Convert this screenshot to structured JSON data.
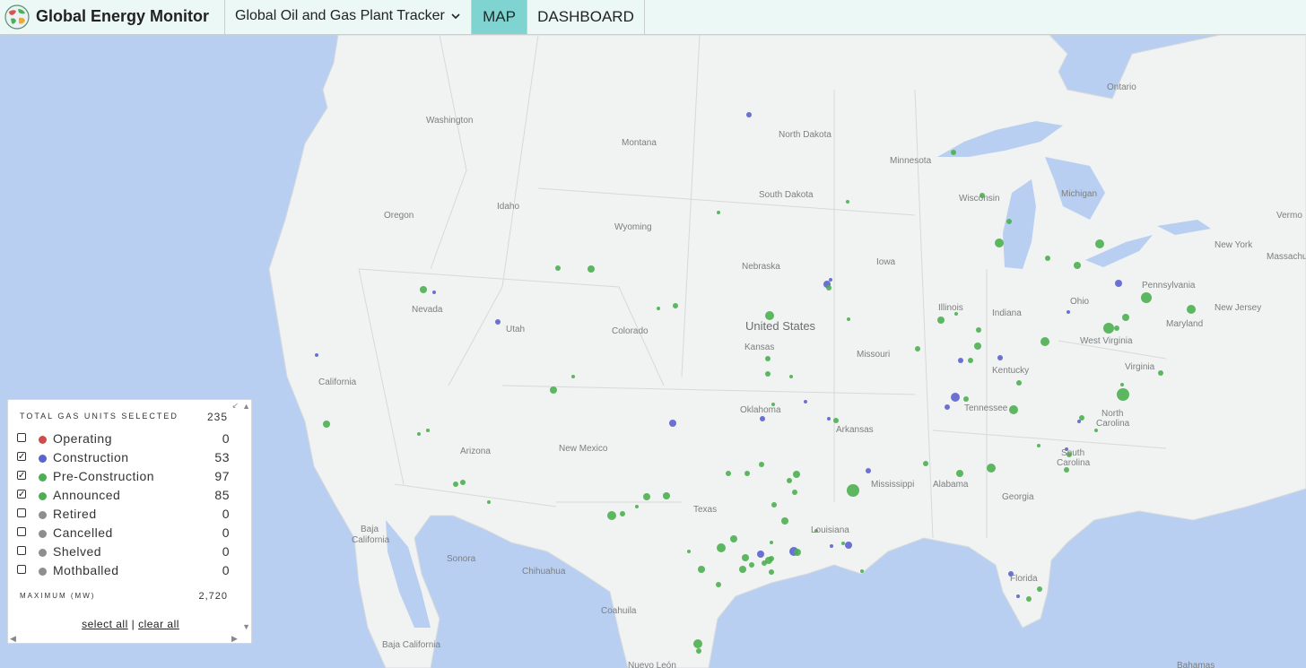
{
  "header": {
    "brand": "Global Energy Monitor",
    "tracker": "Global Oil and Gas Plant Tracker",
    "tabs": [
      "MAP",
      "DASHBOARD"
    ],
    "active_tab": "MAP"
  },
  "colors": {
    "operating": "#d04b4b",
    "construction": "#5b63cf",
    "preconstruction": "#4caf50",
    "announced": "#4caf50",
    "inactive": "#8e8e8e",
    "active_tab": "#7fd3d0",
    "water": "#b9cff1"
  },
  "map": {
    "labels": {
      "ontario": "Ontario",
      "washington": "Washington",
      "montana": "Montana",
      "north_dakota": "North Dakota",
      "minnesota": "Minnesota",
      "wisconsin": "Wisconsin",
      "michigan": "Michigan",
      "oregon": "Oregon",
      "idaho": "Idaho",
      "wyoming": "Wyoming",
      "south_dakota": "South Dakota",
      "nebraska": "Nebraska",
      "iowa": "Iowa",
      "new_york": "New York",
      "massachusetts": "Massachu",
      "vermont": "Vermo",
      "nevada": "Nevada",
      "utah": "Utah",
      "colorado": "Colorado",
      "united_states": "United States",
      "kansas": "Kansas",
      "missouri": "Missouri",
      "illinois": "Illinois",
      "indiana": "Indiana",
      "ohio": "Ohio",
      "pennsylvania": "Pennsylvania",
      "new_jersey": "New Jersey",
      "maryland": "Maryland",
      "west_virginia": "West Virginia",
      "virginia": "Virginia",
      "kentucky": "Kentucky",
      "california": "California",
      "oklahoma": "Oklahoma",
      "arkansas": "Arkansas",
      "tennessee": "Tennessee",
      "north_carolina_1": "North",
      "north_carolina_2": "Carolina",
      "arizona": "Arizona",
      "new_mexico": "New Mexico",
      "south_carolina_1": "South",
      "south_carolina_2": "Carolina",
      "mississippi": "Mississippi",
      "alabama": "Alabama",
      "georgia": "Georgia",
      "texas": "Texas",
      "louisiana": "Louisiana",
      "baja_california_1": "Baja",
      "baja_california_2": "California",
      "sonora": "Sonora",
      "chihuahua": "Chihuahua",
      "coahuila": "Coahuila",
      "florida": "Florida",
      "baja_california_sur": "Baja California",
      "nuevo_leon": "Nuevo León",
      "bahamas": "Bahamas"
    },
    "plants": [
      [
        835,
        128,
        "c",
        3
      ],
      [
        945,
        225,
        "a",
        2
      ],
      [
        801,
        237,
        "a",
        2
      ],
      [
        1063,
        170,
        "a",
        3
      ],
      [
        1095,
        218,
        "a",
        3
      ],
      [
        1125,
        247,
        "a",
        3
      ],
      [
        1114,
        271,
        "a",
        5
      ],
      [
        1168,
        288,
        "a",
        3
      ],
      [
        1201,
        296,
        "a",
        4
      ],
      [
        1226,
        272,
        "a",
        5
      ],
      [
        622,
        299,
        "a",
        3
      ],
      [
        659,
        300,
        "a",
        4
      ],
      [
        472,
        323,
        "a",
        4
      ],
      [
        484,
        326,
        "c",
        2
      ],
      [
        555,
        359,
        "c",
        3
      ],
      [
        734,
        344,
        "a",
        2
      ],
      [
        753,
        341,
        "a",
        3
      ],
      [
        922,
        317,
        "c",
        4
      ],
      [
        926,
        312,
        "c",
        2
      ],
      [
        924,
        321,
        "a",
        3
      ],
      [
        858,
        352,
        "a",
        5
      ],
      [
        946,
        356,
        "a",
        2
      ],
      [
        1247,
        316,
        "c",
        4
      ],
      [
        1278,
        332,
        "a",
        6
      ],
      [
        1328,
        345,
        "a",
        5
      ],
      [
        1191,
        348,
        "c",
        2
      ],
      [
        1255,
        354,
        "a",
        4
      ],
      [
        1236,
        366,
        "a",
        6
      ],
      [
        1245,
        366,
        "a",
        3
      ],
      [
        1165,
        381,
        "a",
        5
      ],
      [
        1049,
        357,
        "a",
        4
      ],
      [
        1066,
        350,
        "a",
        2
      ],
      [
        1091,
        368,
        "a",
        3
      ],
      [
        1090,
        386,
        "a",
        4
      ],
      [
        1023,
        389,
        "a",
        3
      ],
      [
        1071,
        402,
        "c",
        3
      ],
      [
        1082,
        402,
        "a",
        3
      ],
      [
        1115,
        399,
        "c",
        3
      ],
      [
        1136,
        427,
        "a",
        3
      ],
      [
        1251,
        429,
        "a",
        2
      ],
      [
        1294,
        416,
        "a",
        3
      ],
      [
        1252,
        440,
        "a",
        7
      ],
      [
        1065,
        443,
        "c",
        5
      ],
      [
        1056,
        454,
        "c",
        3
      ],
      [
        1077,
        445,
        "a",
        3
      ],
      [
        1130,
        457,
        "a",
        5
      ],
      [
        1206,
        466,
        "a",
        3
      ],
      [
        1203,
        470,
        "c",
        2
      ],
      [
        1222,
        480,
        "a",
        2
      ],
      [
        1158,
        497,
        "a",
        2
      ],
      [
        1189,
        501,
        "c",
        2
      ],
      [
        1192,
        507,
        "a",
        3
      ],
      [
        1189,
        524,
        "a",
        3
      ],
      [
        1105,
        522,
        "a",
        5
      ],
      [
        1070,
        528,
        "a",
        4
      ],
      [
        1032,
        517,
        "a",
        3
      ],
      [
        1127,
        640,
        "c",
        3
      ],
      [
        1159,
        657,
        "a",
        3
      ],
      [
        1135,
        665,
        "c",
        2
      ],
      [
        1147,
        668,
        "a",
        3
      ],
      [
        856,
        400,
        "a",
        3
      ],
      [
        856,
        417,
        "a",
        3
      ],
      [
        882,
        420,
        "a",
        2
      ],
      [
        898,
        448,
        "c",
        2
      ],
      [
        862,
        451,
        "a",
        2
      ],
      [
        850,
        467,
        "c",
        3
      ],
      [
        924,
        467,
        "c",
        2
      ],
      [
        932,
        469,
        "a",
        3
      ],
      [
        750,
        472,
        "c",
        4
      ],
      [
        353,
        396,
        "c",
        2
      ],
      [
        364,
        473,
        "a",
        4
      ],
      [
        467,
        484,
        "a",
        2
      ],
      [
        477,
        480,
        "a",
        2
      ],
      [
        617,
        435,
        "a",
        4
      ],
      [
        639,
        420,
        "a",
        2
      ],
      [
        516,
        538,
        "a",
        3
      ],
      [
        508,
        540,
        "a",
        3
      ],
      [
        545,
        560,
        "a",
        2
      ],
      [
        743,
        553,
        "a",
        4
      ],
      [
        721,
        554,
        "a",
        4
      ],
      [
        710,
        565,
        "a",
        2
      ],
      [
        694,
        573,
        "a",
        3
      ],
      [
        682,
        575,
        "a",
        5
      ],
      [
        812,
        528,
        "a",
        3
      ],
      [
        833,
        528,
        "a",
        3
      ],
      [
        849,
        518,
        "a",
        3
      ],
      [
        880,
        536,
        "a",
        3
      ],
      [
        888,
        529,
        "a",
        4
      ],
      [
        886,
        549,
        "a",
        3
      ],
      [
        863,
        563,
        "a",
        3
      ],
      [
        875,
        581,
        "a",
        4
      ],
      [
        951,
        547,
        "a",
        7
      ],
      [
        968,
        525,
        "c",
        3
      ],
      [
        860,
        605,
        "a",
        2
      ],
      [
        818,
        601,
        "a",
        4
      ],
      [
        804,
        611,
        "a",
        5
      ],
      [
        768,
        615,
        "a",
        2
      ],
      [
        782,
        635,
        "a",
        4
      ],
      [
        801,
        652,
        "a",
        3
      ],
      [
        831,
        622,
        "a",
        4
      ],
      [
        838,
        630,
        "a",
        3
      ],
      [
        828,
        635,
        "a",
        4
      ],
      [
        848,
        618,
        "c",
        4
      ],
      [
        857,
        625,
        "a",
        4
      ],
      [
        860,
        623,
        "a",
        3
      ],
      [
        852,
        628,
        "a",
        3
      ],
      [
        860,
        638,
        "a",
        3
      ],
      [
        885,
        615,
        "c",
        5
      ],
      [
        889,
        616,
        "a",
        4
      ],
      [
        910,
        592,
        "a",
        2
      ],
      [
        927,
        609,
        "c",
        2
      ],
      [
        946,
        608,
        "c",
        4
      ],
      [
        940,
        606,
        "a",
        2
      ],
      [
        961,
        637,
        "a",
        2
      ],
      [
        778,
        718,
        "a",
        5
      ],
      [
        779,
        726,
        "a",
        3
      ]
    ]
  },
  "legend": {
    "total_label": "TOTAL GAS UNITS SELECTED",
    "total_value": "235",
    "rows": [
      {
        "label": "Operating",
        "value": "0",
        "checked": false
      },
      {
        "label": "Construction",
        "value": "53",
        "checked": true
      },
      {
        "label": "Pre-Construction",
        "value": "97",
        "checked": true
      },
      {
        "label": "Announced",
        "value": "85",
        "checked": true
      },
      {
        "label": "Retired",
        "value": "0",
        "checked": false
      },
      {
        "label": "Cancelled",
        "value": "0",
        "checked": false
      },
      {
        "label": "Shelved",
        "value": "0",
        "checked": false
      },
      {
        "label": "Mothballed",
        "value": "0",
        "checked": false
      }
    ],
    "max_label": "MAXIMUM (MW)",
    "max_value": "2,720",
    "select_all": "select all",
    "separator": "|",
    "clear_all": "clear all",
    "check_glyph": "✓"
  }
}
